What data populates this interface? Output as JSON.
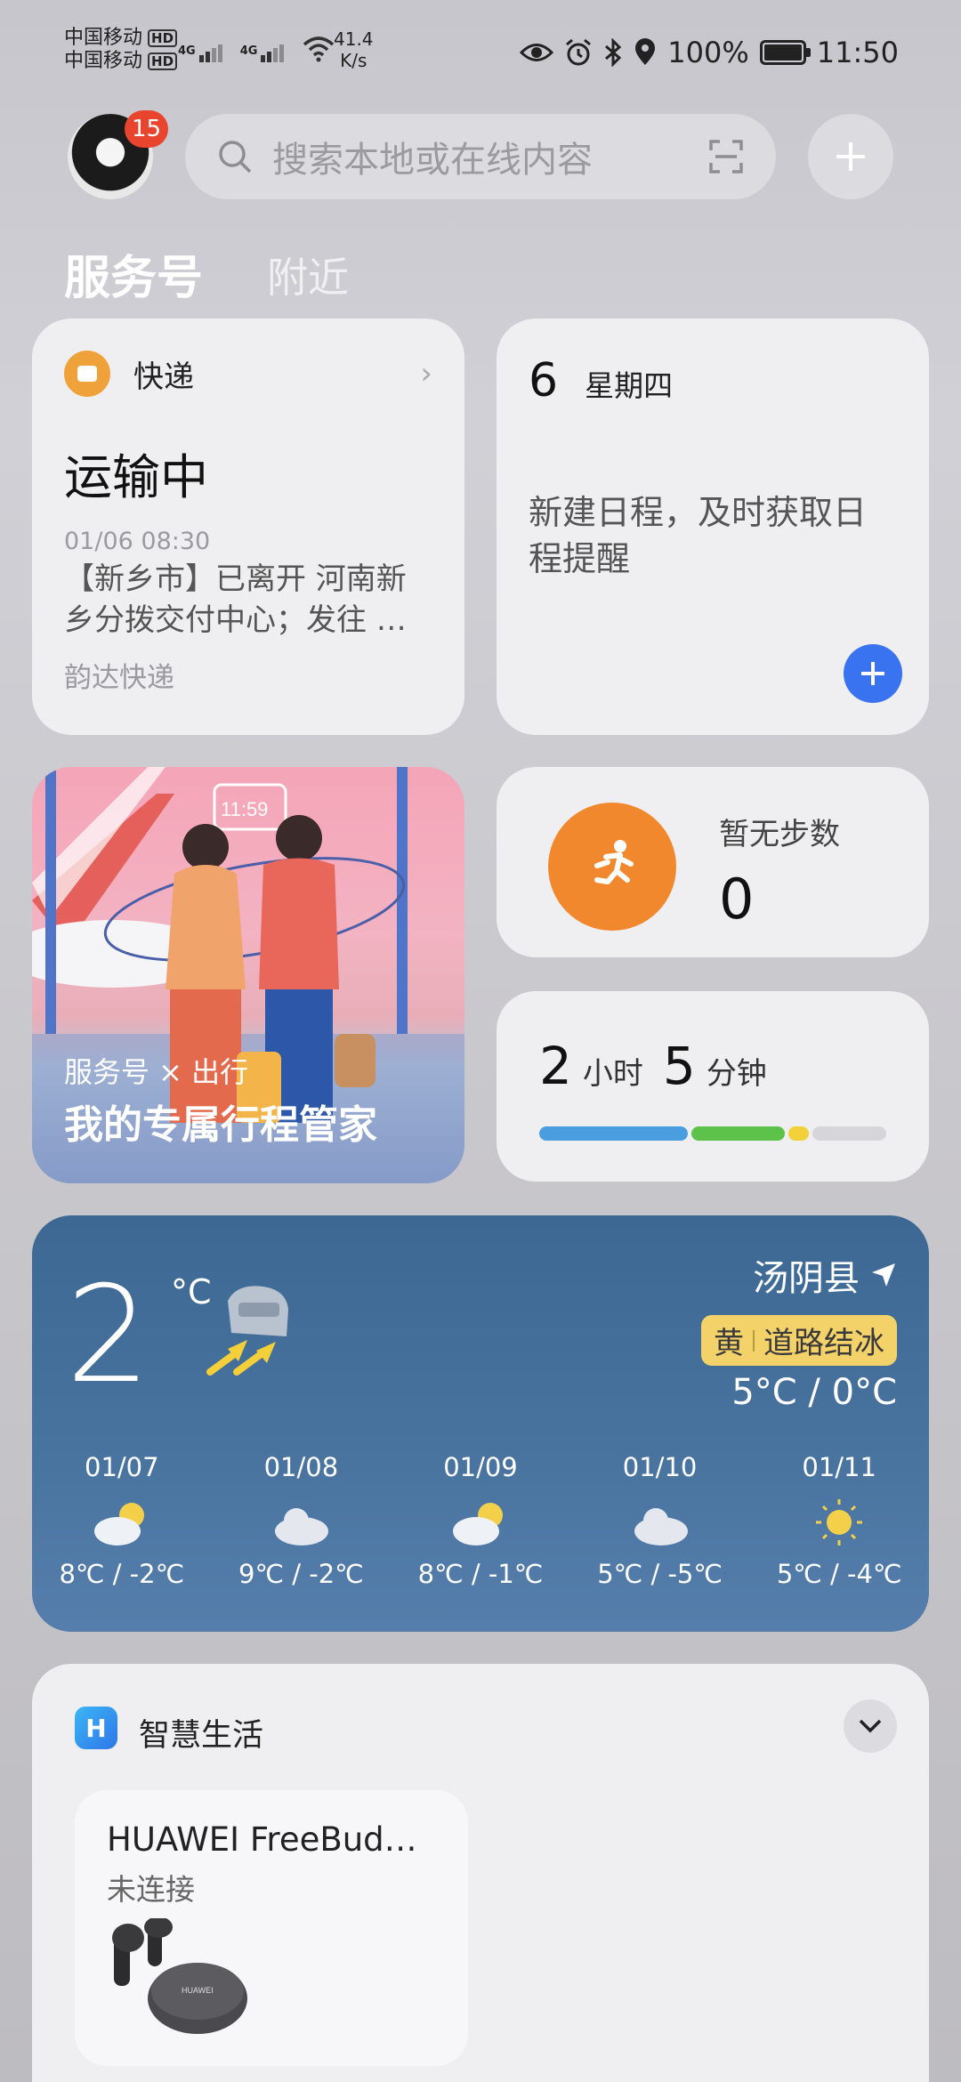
{
  "status": {
    "carrier1": "中国移动",
    "carrier2": "中国移动",
    "hd": "HD",
    "net": "4G",
    "speed_value": "41.4",
    "speed_unit": "K/s",
    "battery": "100%",
    "time": "11:50"
  },
  "header": {
    "badge_count": "15",
    "search_placeholder": "搜索本地或在线内容"
  },
  "tabs": [
    {
      "label": "服务号",
      "active": true
    },
    {
      "label": "附近",
      "active": false
    }
  ],
  "express": {
    "title": "快递",
    "status": "运输中",
    "time": "01/06 08:30",
    "desc": "【新乡市】已离开 河南新乡分拨交付中心；发往 …",
    "company": "韵达快递"
  },
  "calendar": {
    "day": "6",
    "weekday": "星期四",
    "prompt": "新建日程，及时获取日程提醒"
  },
  "travel": {
    "subtitle": "服务号 × 出行",
    "title": "我的专属行程管家",
    "clock_text": "11:59"
  },
  "steps": {
    "label": "暂无步数",
    "value": "0"
  },
  "screen_time": {
    "hours": "2",
    "hours_unit": "小时",
    "minutes": "5",
    "minutes_unit": "分钟",
    "segments": [
      {
        "color": "#4a9ee0",
        "fraction": 0.44
      },
      {
        "color": "#5cc24a",
        "fraction": 0.28
      },
      {
        "color": "#f2d037",
        "fraction": 0.06
      },
      {
        "color": "#d6d6da",
        "fraction": 0.22
      }
    ]
  },
  "weather": {
    "temp": "2",
    "unit": "°C",
    "location": "汤阴县",
    "warning_level": "黄",
    "warning_text": "道路结冰",
    "range": "5°C / 0°C",
    "forecast": [
      {
        "date": "01/07",
        "icon": "partly-cloudy-icon",
        "range": "8℃ / -2℃"
      },
      {
        "date": "01/08",
        "icon": "cloudy-icon",
        "range": "9℃ / -2℃"
      },
      {
        "date": "01/09",
        "icon": "partly-cloudy-icon",
        "range": "8℃ / -1℃"
      },
      {
        "date": "01/10",
        "icon": "cloudy-icon",
        "range": "5℃ / -5℃"
      },
      {
        "date": "01/11",
        "icon": "sunny-icon",
        "range": "5℃ / -4℃"
      }
    ]
  },
  "smart_life": {
    "title": "智慧生活",
    "device_name": "HUAWEI FreeBud…",
    "device_state": "未连接",
    "case_logo": "HUAWEI"
  }
}
